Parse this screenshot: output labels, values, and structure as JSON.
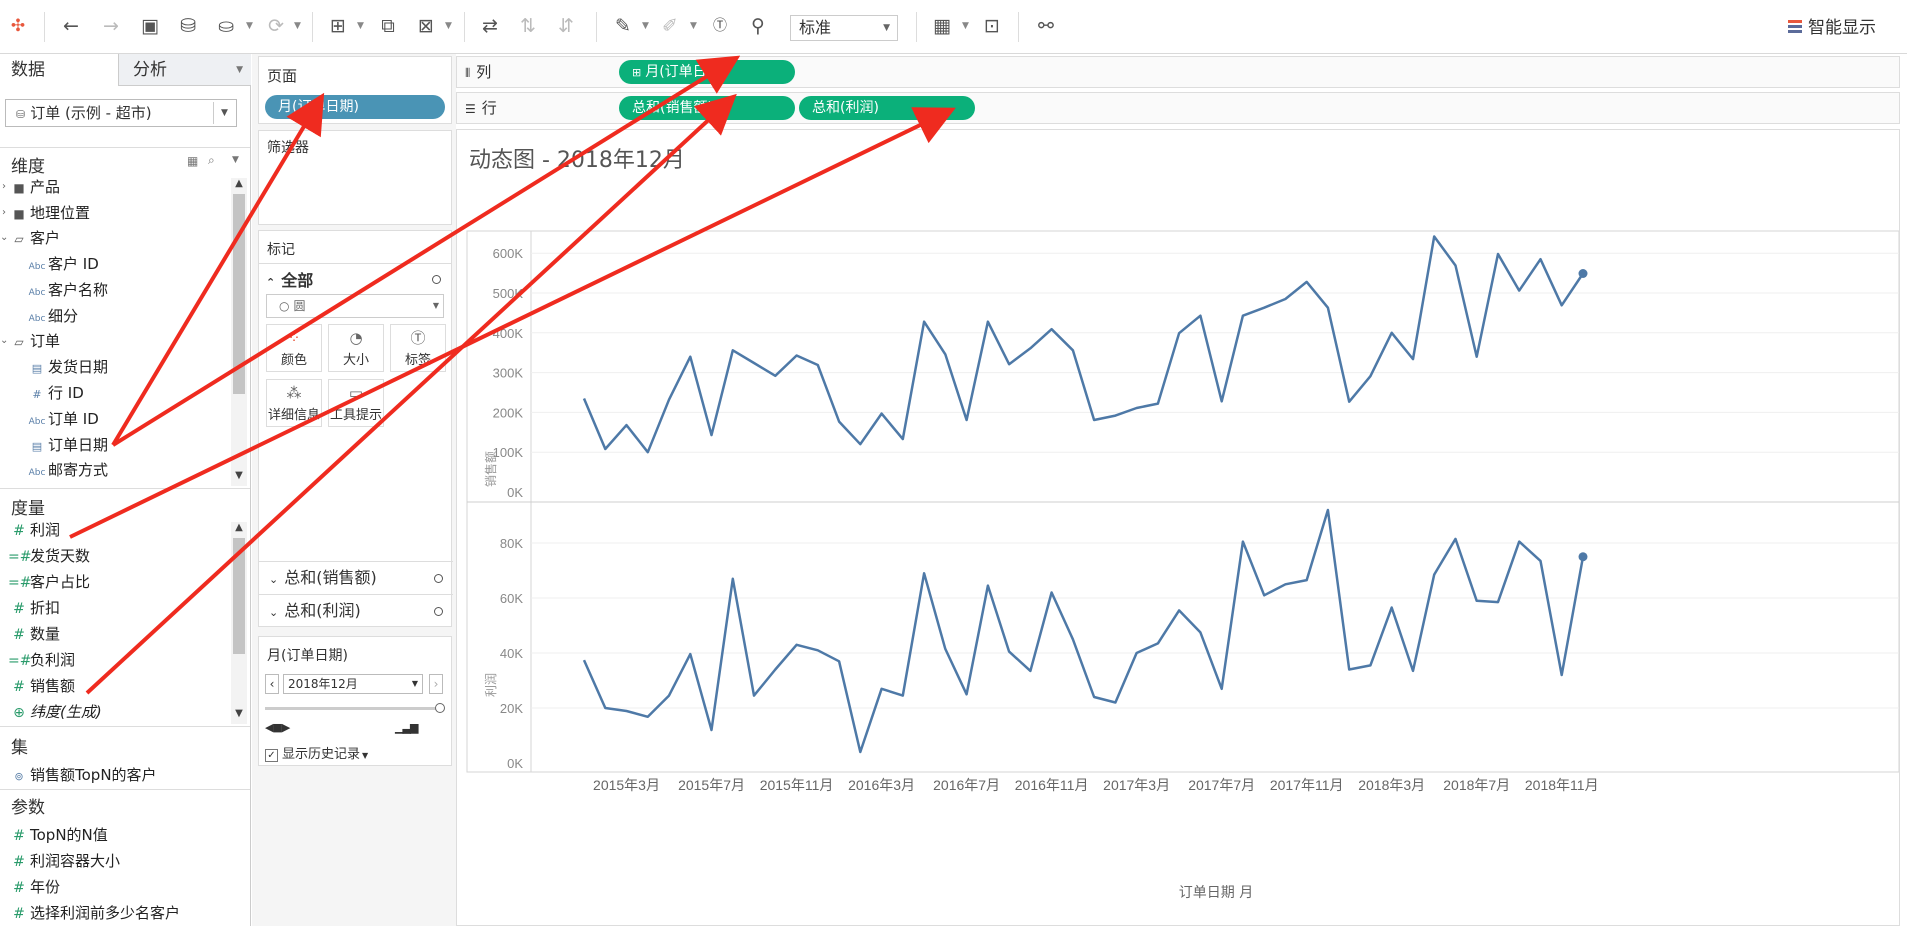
{
  "toolbar": {
    "view_mode": "标准",
    "smart_show": "智能显示"
  },
  "left_pane": {
    "tab_data": "数据",
    "tab_analysis": "分析",
    "datasource": "订单 (示例 - 超市)",
    "dimensions_header": "维度",
    "dimensions": [
      {
        "label": "产品",
        "icon": "folder-icon"
      },
      {
        "label": "地理位置",
        "icon": "folder-icon"
      },
      {
        "label": "客户",
        "icon": "folder-open-icon"
      },
      {
        "label": "客户 ID",
        "icon": "abc-icon"
      },
      {
        "label": "客户名称",
        "icon": "abc-icon"
      },
      {
        "label": "细分",
        "icon": "abc-icon"
      },
      {
        "label": "订单",
        "icon": "folder-open-icon"
      },
      {
        "label": "发货日期",
        "icon": "calendar-icon"
      },
      {
        "label": "行 ID",
        "icon": "hash-icon"
      },
      {
        "label": "订单 ID",
        "icon": "abc-icon"
      },
      {
        "label": "订单日期",
        "icon": "calendar-icon"
      },
      {
        "label": "邮寄方式",
        "icon": "abc-icon"
      }
    ],
    "measures_header": "度量",
    "measures": [
      {
        "label": "利润",
        "icon": "hash-icon"
      },
      {
        "label": "发货天数",
        "icon": "hash-calc-icon"
      },
      {
        "label": "客户占比",
        "icon": "hash-calc-icon"
      },
      {
        "label": "折扣",
        "icon": "hash-icon"
      },
      {
        "label": "数量",
        "icon": "hash-icon"
      },
      {
        "label": "负利润",
        "icon": "hash-calc-icon"
      },
      {
        "label": "销售额",
        "icon": "hash-icon"
      },
      {
        "label": "纬度(生成)",
        "icon": "globe-icon"
      }
    ],
    "sets_header": "集",
    "sets": [
      {
        "label": "销售额TopN的客户",
        "icon": "set-icon"
      }
    ],
    "params_header": "参数",
    "params": [
      {
        "label": "TopN的N值",
        "icon": "hash-icon"
      },
      {
        "label": "利润容器大小",
        "icon": "hash-icon"
      },
      {
        "label": "年份",
        "icon": "hash-icon"
      },
      {
        "label": "选择利润前多少名客户",
        "icon": "hash-icon"
      }
    ]
  },
  "mid_pane": {
    "pages_title": "页面",
    "pages_pill": "月(订单日期)",
    "filters_title": "筛选器",
    "marks_title": "标记",
    "marks_all": "全部",
    "mark_type": "圆",
    "mark_buttons": [
      "颜色",
      "大小",
      "标签",
      "详细信息",
      "工具提示"
    ],
    "mark_rows": [
      "总和(销售额)",
      "总和(利润)"
    ],
    "page_control_title": "月(订单日期)",
    "page_control_value": "2018年12月",
    "show_history": "显示历史记录"
  },
  "shelves": {
    "columns_label": "列",
    "rows_label": "行",
    "columns_pill": "月(订单日期)",
    "rows_pills": [
      "总和(销售额)",
      "总和(利润)"
    ]
  },
  "viz": {
    "title": "动态图 - 2018年12月",
    "xaxis_title": "订单日期 月",
    "top_ylabel": "销售额",
    "bottom_ylabel": "利润",
    "top_ticks": [
      "600K",
      "500K",
      "400K",
      "300K",
      "200K",
      "100K",
      "0K"
    ],
    "bottom_ticks": [
      "80K",
      "60K",
      "40K",
      "20K",
      "0K"
    ],
    "x_ticks": [
      "2015年3月",
      "2015年7月",
      "2015年11月",
      "2016年3月",
      "2016年7月",
      "2016年11月",
      "2017年3月",
      "2017年7月",
      "2017年11月",
      "2018年3月",
      "2018年7月",
      "2018年11月"
    ]
  },
  "chart_data": [
    {
      "type": "line",
      "xlabel": "订单日期 月",
      "ylabel": "销售额",
      "ylim": [
        0,
        650000
      ],
      "x_start": "2015年1月",
      "x_end": "2018年12月",
      "series": [
        {
          "name": "总和(销售额)",
          "color": "#4e79a7",
          "values": [
            235000,
            108000,
            168000,
            100000,
            232000,
            340000,
            143000,
            356000,
            324000,
            292000,
            343000,
            319000,
            177000,
            120000,
            197000,
            133000,
            428000,
            346000,
            181000,
            428000,
            321000,
            361000,
            409000,
            356000,
            181000,
            192000,
            211000,
            222000,
            399000,
            443000,
            228000,
            443000,
            463000,
            485000,
            528000,
            463000,
            227000,
            291000,
            400000,
            334000,
            642000,
            569000,
            340000,
            598000,
            506000,
            585000,
            469000,
            549000
          ]
        }
      ]
    },
    {
      "type": "line",
      "xlabel": "订单日期 月",
      "ylabel": "利润",
      "ylim": [
        0,
        92000
      ],
      "x_start": "2015年1月",
      "x_end": "2018年12月",
      "series": [
        {
          "name": "总和(利润)",
          "color": "#4e79a7",
          "values": [
            37400,
            20000,
            18900,
            16800,
            24500,
            39600,
            12000,
            67000,
            24500,
            34000,
            43000,
            41000,
            37000,
            4000,
            27000,
            24500,
            69000,
            41500,
            25000,
            64500,
            40500,
            33500,
            62000,
            45000,
            24000,
            22000,
            40000,
            43500,
            55500,
            47500,
            27000,
            80500,
            61000,
            65000,
            66500,
            92000,
            34000,
            35500,
            56500,
            33500,
            68500,
            81500,
            59000,
            58500,
            80500,
            73500,
            32000,
            75000
          ]
        }
      ]
    }
  ]
}
